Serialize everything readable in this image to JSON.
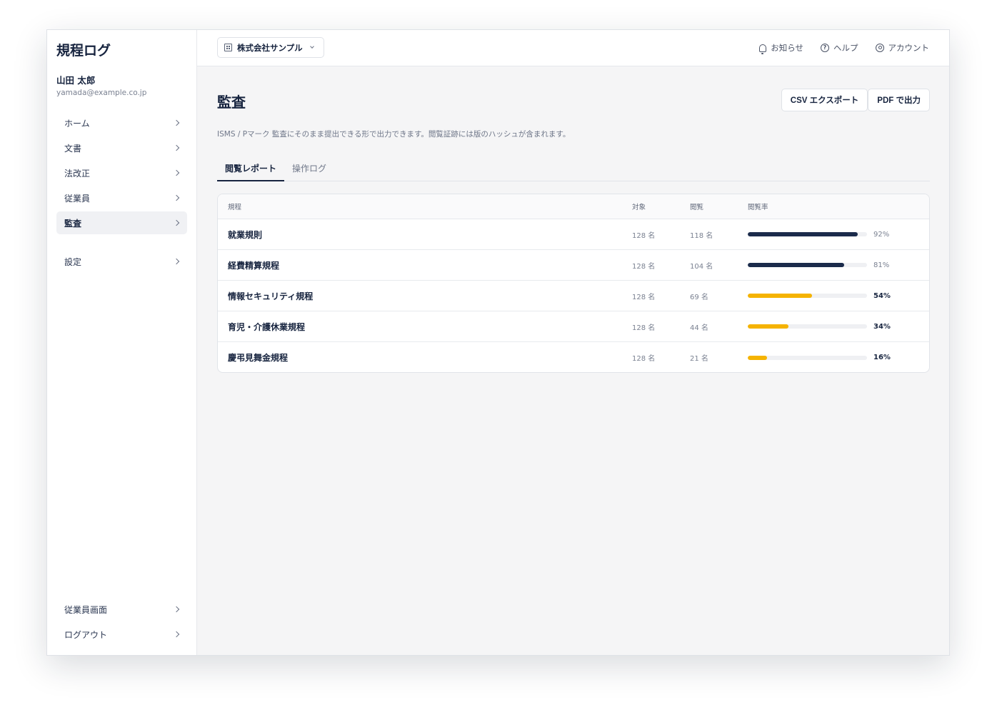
{
  "app": {
    "title": "規程ログ"
  },
  "user": {
    "name": "山田 太郎",
    "email": "yamada@example.co.jp"
  },
  "sidebar": {
    "items": [
      {
        "label": "ホーム"
      },
      {
        "label": "文書"
      },
      {
        "label": "法改正"
      },
      {
        "label": "従業員"
      },
      {
        "label": "監査"
      }
    ],
    "settings": {
      "label": "設定"
    },
    "bottom": [
      {
        "label": "従業員画面"
      },
      {
        "label": "ログアウト"
      }
    ]
  },
  "topbar": {
    "org": "株式会社サンプル",
    "actions": [
      {
        "label": "お知らせ",
        "icon": "bell-icon"
      },
      {
        "label": "ヘルプ",
        "icon": "help-icon"
      },
      {
        "label": "アカウント",
        "icon": "account-icon"
      }
    ]
  },
  "page": {
    "title": "監査",
    "description": "ISMS / Pマーク 監査にそのまま提出できる形で出力できます。閲覧証跡には版のハッシュが含まれます。",
    "buttons": {
      "csv": "CSV エクスポート",
      "pdf": "PDF で出力"
    },
    "tabs": [
      {
        "label": "閲覧レポート"
      },
      {
        "label": "操作ログ"
      }
    ]
  },
  "table": {
    "headers": {
      "name": "規程",
      "target": "対象",
      "viewed": "閲覧",
      "rate": "閲覧率"
    },
    "rows": [
      {
        "name": "就業規則",
        "target": "128 名",
        "viewed": "118 名",
        "rate": 92,
        "rate_label": "92%"
      },
      {
        "name": "経費精算規程",
        "target": "128 名",
        "viewed": "104 名",
        "rate": 81,
        "rate_label": "81%"
      },
      {
        "name": "情報セキュリティ規程",
        "target": "128 名",
        "viewed": "69 名",
        "rate": 54,
        "rate_label": "54%"
      },
      {
        "name": "育児・介護休業規程",
        "target": "128 名",
        "viewed": "44 名",
        "rate": 34,
        "rate_label": "34%"
      },
      {
        "name": "慶弔見舞金規程",
        "target": "128 名",
        "viewed": "21 名",
        "rate": 16,
        "rate_label": "16%"
      }
    ],
    "colors": {
      "high": "#1b2b4b",
      "low": "#f5b301"
    }
  }
}
